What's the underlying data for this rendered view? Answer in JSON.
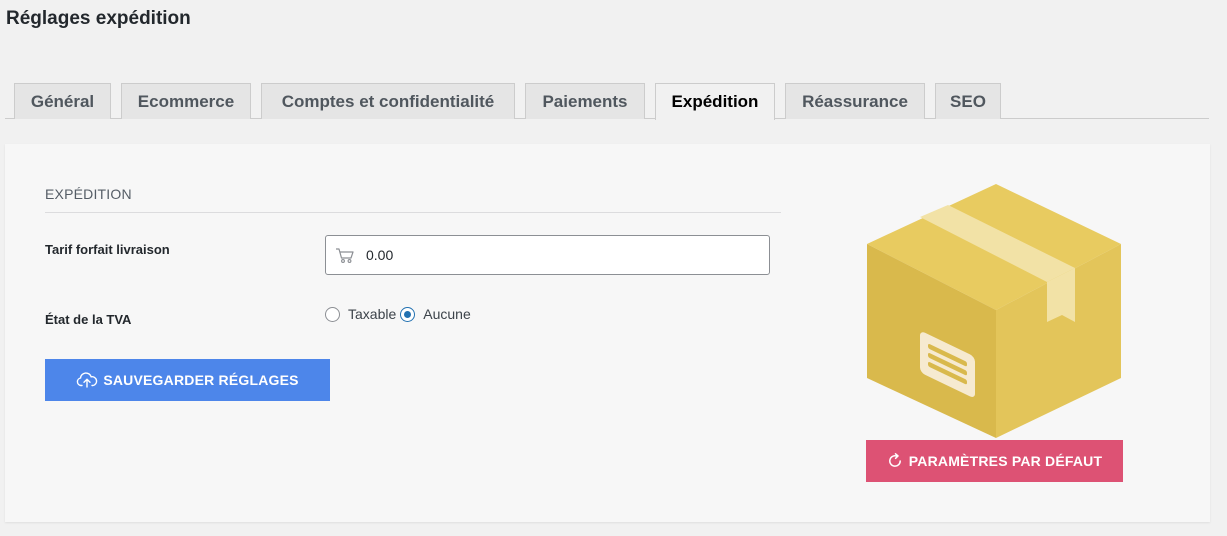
{
  "page": {
    "title": "Réglages expédition"
  },
  "tabs": [
    {
      "label": "Général"
    },
    {
      "label": "Ecommerce"
    },
    {
      "label": "Comptes et confidentialité"
    },
    {
      "label": "Paiements"
    },
    {
      "label": "Expédition",
      "active": true
    },
    {
      "label": "Réassurance"
    },
    {
      "label": "SEO"
    }
  ],
  "section": {
    "title": "EXPÉDITION"
  },
  "fields": {
    "shipping_rate": {
      "label": "Tarif forfait livraison",
      "value": "0.00",
      "icon": "cart-icon"
    },
    "vat_state": {
      "label": "État de la TVA",
      "options": [
        {
          "label": "Taxable",
          "checked": false
        },
        {
          "label": "Aucune",
          "checked": true
        }
      ]
    }
  },
  "buttons": {
    "save": {
      "label": "SAUVEGARDER RÉGLAGES",
      "icon": "cloud-upload-icon",
      "color": "#4d86ea"
    },
    "reset": {
      "label": "PARAMÈTRES PAR DÉFAUT",
      "icon": "refresh-icon",
      "color": "#dd5274"
    }
  },
  "illustration": {
    "icon": "package-box-icon",
    "color": "#e3c55a"
  }
}
